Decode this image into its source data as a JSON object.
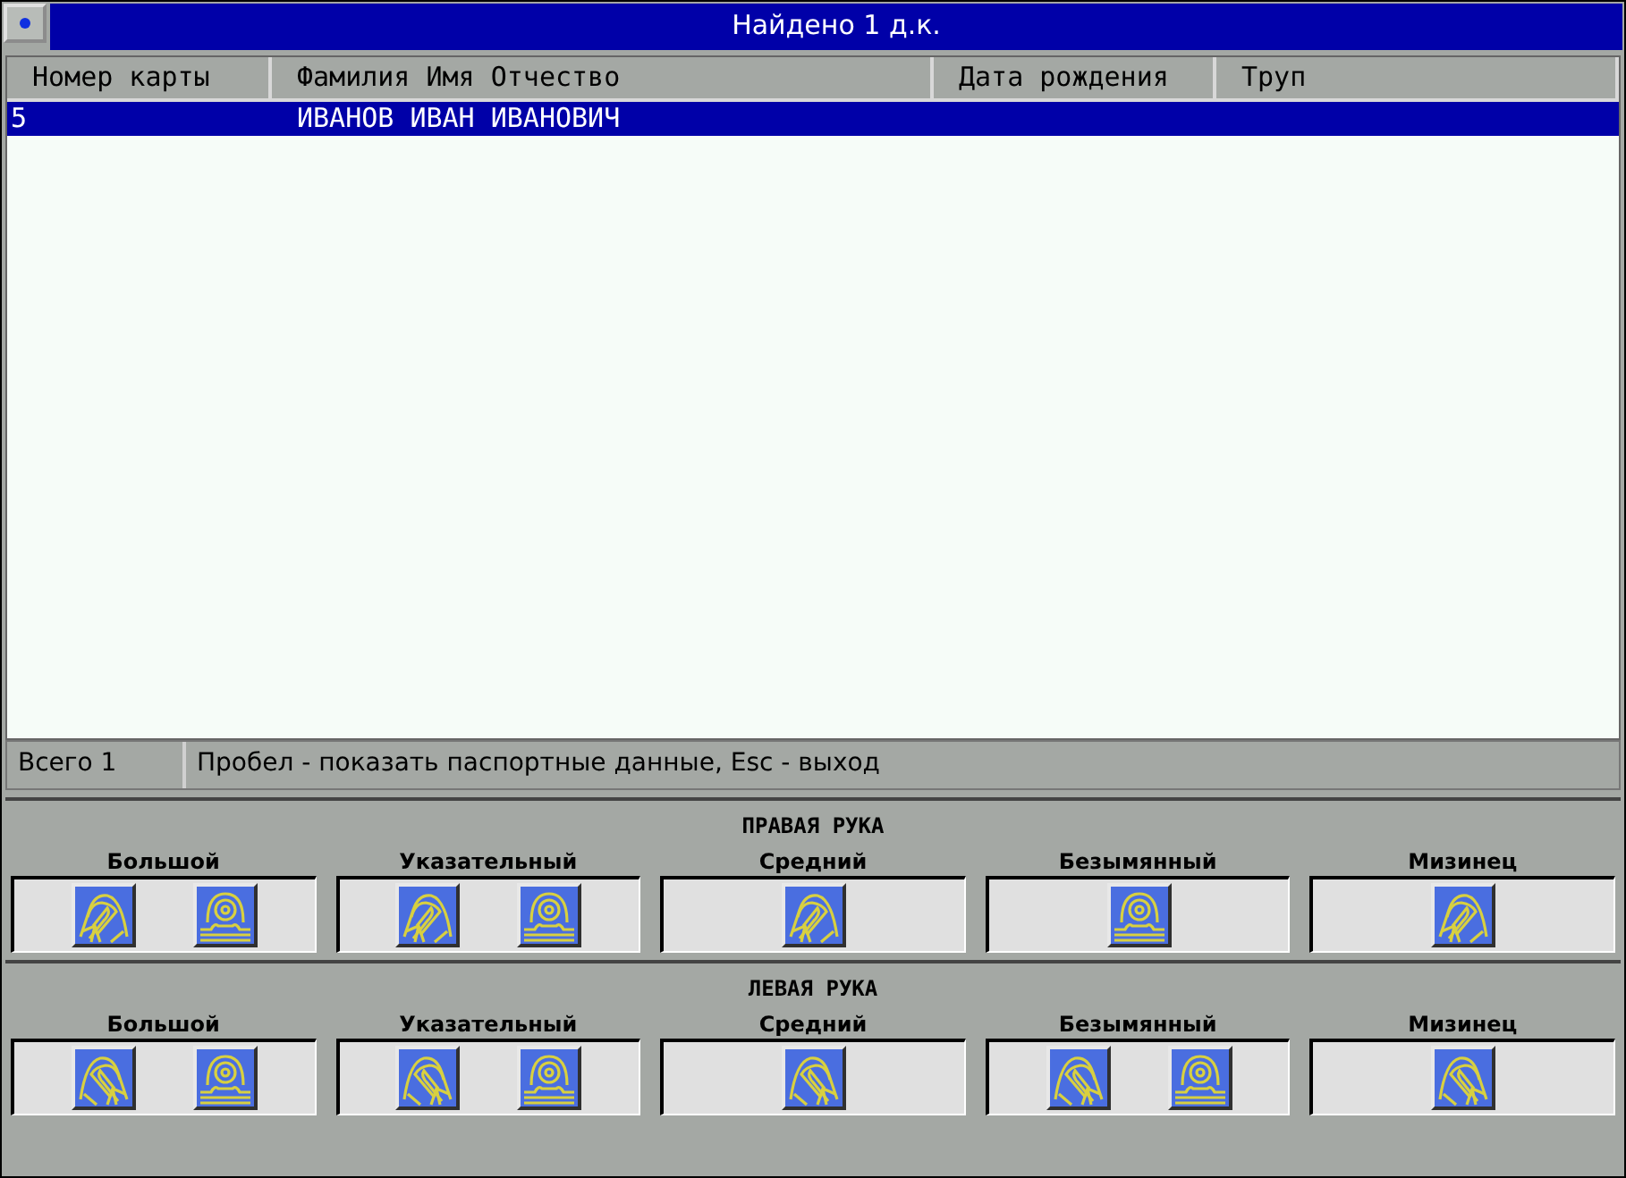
{
  "window": {
    "title": "Найдено 1 д.к."
  },
  "table": {
    "columns": [
      "Номер карты",
      "Фамилия  Имя Отчество",
      "Дата рождения",
      "Труп"
    ],
    "rows": [
      {
        "cells": [
          "5",
          "ИВАНОВ ИВАН ИВАНОВИЧ"
        ],
        "selected": true
      }
    ]
  },
  "status_bar": {
    "total": "Всего 1",
    "hint": "Пробел - показать паспортные данные, Esc - выход"
  },
  "hands": [
    {
      "title": "ПРАВАЯ РУКА",
      "fingers": [
        {
          "name": "Большой",
          "patterns": [
            {
              "kind": "loop_right"
            },
            {
              "kind": "whorl"
            }
          ]
        },
        {
          "name": "Указательный",
          "patterns": [
            {
              "kind": "loop_right"
            },
            {
              "kind": "whorl"
            }
          ]
        },
        {
          "name": "Средний",
          "patterns": [
            {
              "kind": "loop_right"
            }
          ]
        },
        {
          "name": "Безымянный",
          "patterns": [
            {
              "kind": "whorl"
            }
          ]
        },
        {
          "name": "Мизинец",
          "patterns": [
            {
              "kind": "loop_right"
            }
          ]
        }
      ]
    },
    {
      "title": "ЛЕВАЯ РУКА",
      "fingers": [
        {
          "name": "Большой",
          "patterns": [
            {
              "kind": "loop_left"
            },
            {
              "kind": "whorl"
            }
          ]
        },
        {
          "name": "Указательный",
          "patterns": [
            {
              "kind": "loop_left"
            },
            {
              "kind": "whorl"
            }
          ]
        },
        {
          "name": "Средний",
          "patterns": [
            {
              "kind": "loop_left"
            }
          ]
        },
        {
          "name": "Безымянный",
          "patterns": [
            {
              "kind": "loop_left"
            },
            {
              "kind": "whorl"
            }
          ]
        },
        {
          "name": "Мизинец",
          "patterns": [
            {
              "kind": "loop_left"
            }
          ]
        }
      ]
    }
  ]
}
